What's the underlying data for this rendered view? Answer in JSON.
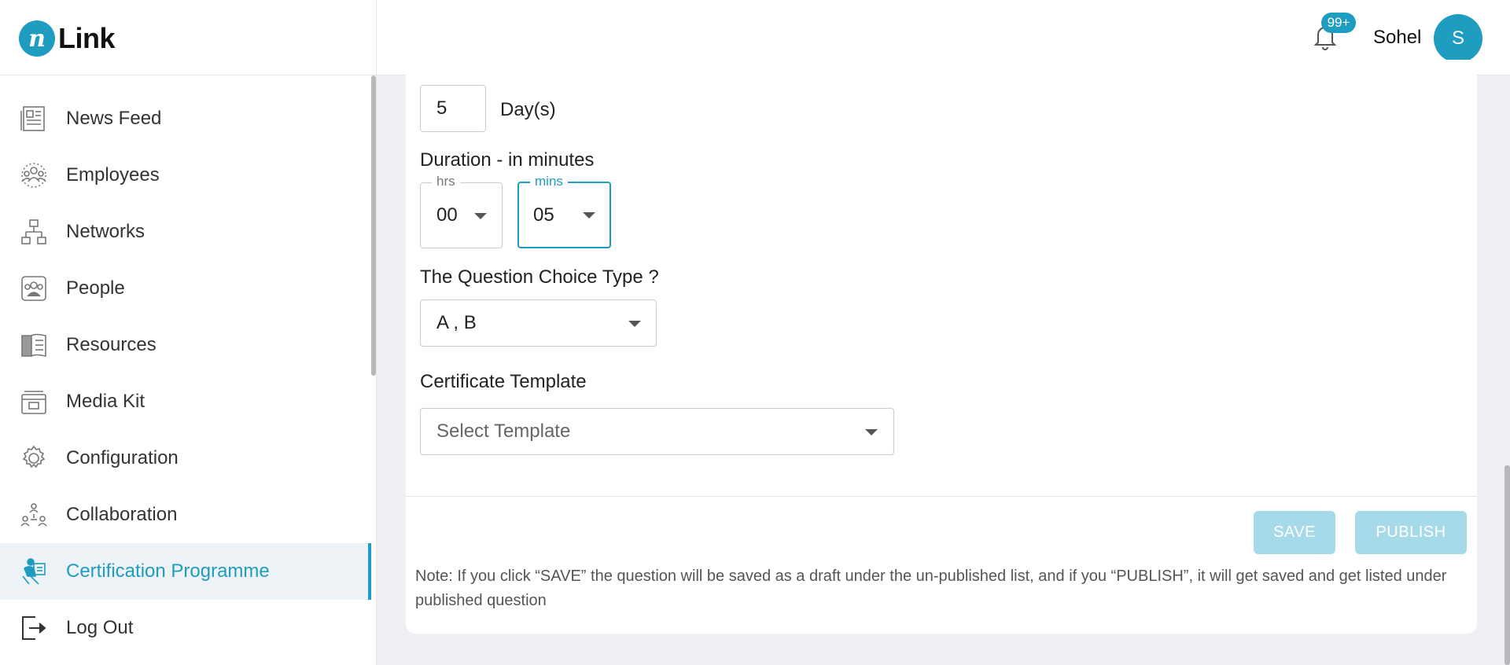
{
  "brand": {
    "logo_letter": "n",
    "logo_text": "Link",
    "accent_color": "#1e9dc0"
  },
  "header": {
    "notification_count": "99+",
    "user_name": "Sohel",
    "avatar_initial": "S"
  },
  "sidebar": {
    "items": [
      {
        "label": "News Feed",
        "icon": "newspaper-icon"
      },
      {
        "label": "Employees",
        "icon": "employees-icon"
      },
      {
        "label": "Networks",
        "icon": "network-icon"
      },
      {
        "label": "People",
        "icon": "people-icon"
      },
      {
        "label": "Resources",
        "icon": "book-icon"
      },
      {
        "label": "Media Kit",
        "icon": "media-kit-icon"
      },
      {
        "label": "Configuration",
        "icon": "gear-icon"
      },
      {
        "label": "Collaboration",
        "icon": "collaboration-icon"
      },
      {
        "label": "Certification Programme",
        "icon": "certification-icon",
        "active": true
      },
      {
        "label": "Log Out",
        "icon": "logout-icon"
      }
    ]
  },
  "form": {
    "days_value": "5",
    "days_label": "Day(s)",
    "duration_title": "Duration - in minutes",
    "hrs_label": "hrs",
    "hrs_value": "00",
    "mins_label": "mins",
    "mins_value": "05",
    "choice_type_title": "The Question Choice Type ?",
    "choice_type_value": "A , B",
    "certificate_title": "Certificate Template",
    "certificate_placeholder": "Select Template"
  },
  "actions": {
    "save_label": "SAVE",
    "publish_label": "PUBLISH",
    "note": "Note: If you click “SAVE” the question will be saved as a draft under the un-published list, and if you “PUBLISH”, it will get saved and get listed under published question"
  }
}
